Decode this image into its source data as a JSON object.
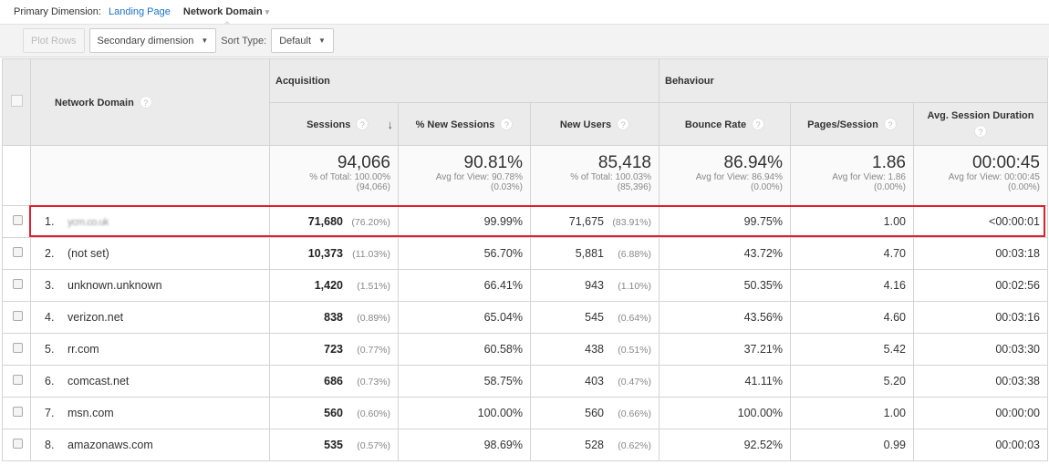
{
  "primary_dimension": {
    "label": "Primary Dimension:",
    "options": [
      {
        "label": "Landing Page",
        "active": false
      },
      {
        "label": "Network Domain",
        "active": true
      }
    ]
  },
  "toolbar": {
    "plot_rows": "Plot Rows",
    "secondary_dimension": "Secondary dimension",
    "sort_type_label": "Sort Type:",
    "sort_type_value": "Default"
  },
  "table": {
    "dimension_header": "Network Domain",
    "groups": {
      "acquisition": "Acquisition",
      "behaviour": "Behaviour"
    },
    "columns": {
      "sessions": "Sessions",
      "new_sessions": "% New Sessions",
      "new_users": "New Users",
      "bounce_rate": "Bounce Rate",
      "pages_session": "Pages/Session",
      "avg_duration": "Avg. Session Duration"
    },
    "totals": {
      "sessions": {
        "main": "94,066",
        "sub1": "% of Total: 100.00%",
        "sub2": "(94,066)"
      },
      "new_sessions": {
        "main": "90.81%",
        "sub1": "Avg for View: 90.78%",
        "sub2": "(0.03%)"
      },
      "new_users": {
        "main": "85,418",
        "sub1": "% of Total: 100.03%",
        "sub2": "(85,396)"
      },
      "bounce_rate": {
        "main": "86.94%",
        "sub1": "Avg for View: 86.94%",
        "sub2": "(0.00%)"
      },
      "pages_session": {
        "main": "1.86",
        "sub1": "Avg for View: 1.86",
        "sub2": "(0.00%)"
      },
      "avg_duration": {
        "main": "00:00:45",
        "sub1": "Avg for View: 00:00:45",
        "sub2": "(0.00%)"
      }
    },
    "rows": [
      {
        "idx": "1.",
        "domain": "ycm.co.uk",
        "sessions": "71,680",
        "sessions_pct": "(76.20%)",
        "new_sessions": "99.99%",
        "new_users": "71,675",
        "new_users_pct": "(83.91%)",
        "bounce_rate": "99.75%",
        "pages_session": "1.00",
        "avg_duration": "<00:00:01"
      },
      {
        "idx": "2.",
        "domain": "(not set)",
        "sessions": "10,373",
        "sessions_pct": "(11.03%)",
        "new_sessions": "56.70%",
        "new_users": "5,881",
        "new_users_pct": "(6.88%)",
        "bounce_rate": "43.72%",
        "pages_session": "4.70",
        "avg_duration": "00:03:18"
      },
      {
        "idx": "3.",
        "domain": "unknown.unknown",
        "sessions": "1,420",
        "sessions_pct": "(1.51%)",
        "new_sessions": "66.41%",
        "new_users": "943",
        "new_users_pct": "(1.10%)",
        "bounce_rate": "50.35%",
        "pages_session": "4.16",
        "avg_duration": "00:02:56"
      },
      {
        "idx": "4.",
        "domain": "verizon.net",
        "sessions": "838",
        "sessions_pct": "(0.89%)",
        "new_sessions": "65.04%",
        "new_users": "545",
        "new_users_pct": "(0.64%)",
        "bounce_rate": "43.56%",
        "pages_session": "4.60",
        "avg_duration": "00:03:16"
      },
      {
        "idx": "5.",
        "domain": "rr.com",
        "sessions": "723",
        "sessions_pct": "(0.77%)",
        "new_sessions": "60.58%",
        "new_users": "438",
        "new_users_pct": "(0.51%)",
        "bounce_rate": "37.21%",
        "pages_session": "5.42",
        "avg_duration": "00:03:30"
      },
      {
        "idx": "6.",
        "domain": "comcast.net",
        "sessions": "686",
        "sessions_pct": "(0.73%)",
        "new_sessions": "58.75%",
        "new_users": "403",
        "new_users_pct": "(0.47%)",
        "bounce_rate": "41.11%",
        "pages_session": "5.20",
        "avg_duration": "00:03:38"
      },
      {
        "idx": "7.",
        "domain": "msn.com",
        "sessions": "560",
        "sessions_pct": "(0.60%)",
        "new_sessions": "100.00%",
        "new_users": "560",
        "new_users_pct": "(0.66%)",
        "bounce_rate": "100.00%",
        "pages_session": "1.00",
        "avg_duration": "00:00:00"
      },
      {
        "idx": "8.",
        "domain": "amazonaws.com",
        "sessions": "535",
        "sessions_pct": "(0.57%)",
        "new_sessions": "98.69%",
        "new_users": "528",
        "new_users_pct": "(0.62%)",
        "bounce_rate": "92.52%",
        "pages_session": "0.99",
        "avg_duration": "00:00:03"
      }
    ]
  },
  "icons": {
    "help": "?",
    "sort_arrow": "↓",
    "dropdown": "▼",
    "caret": "▾"
  },
  "colors": {
    "link": "#1a73c8",
    "highlight": "#e01f2b"
  }
}
